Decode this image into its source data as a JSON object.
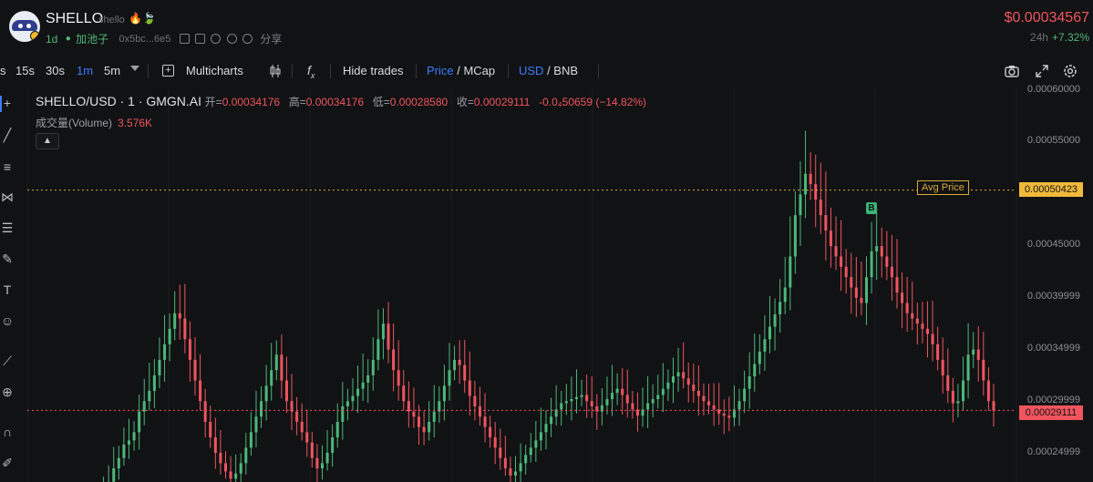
{
  "header": {
    "token_name": "SHELLO",
    "token_sub": "shello",
    "flame_icon": "🔥",
    "leaf_icon": "🍃",
    "age": "1d",
    "pool_icon": "pool-icon",
    "pool_label": "加池子",
    "address": "0x5bc...6e5",
    "share_label": "分享",
    "price": "$0.00034567",
    "change_period": "24h",
    "change_value": "+7.32%"
  },
  "toolbar": {
    "intervals": [
      "s",
      "15s",
      "30s",
      "1m",
      "5m"
    ],
    "active_interval": "1m",
    "multicharts_label": "Multicharts",
    "hide_trades_label": "Hide trades",
    "price_label": "Price",
    "slash1": " / ",
    "mcap_label": "MCap",
    "usd_label": "USD",
    "slash2": " / ",
    "bnb_label": "BNB"
  },
  "legend": {
    "pair": "SHELLO/USD · 1 · GMGN.AI",
    "open_label": "开=",
    "open_value": "0.00034176",
    "high_label": "高=",
    "high_value": "0.00034176",
    "low_label": "低=",
    "low_value": "0.00028580",
    "close_label": "收=",
    "close_value": "0.00029111",
    "change_value": "-0.0₄50659 (−14.82%)",
    "volume_label": "成交量(Volume)",
    "volume_value": "3.576K"
  },
  "price_axis": {
    "ticks": [
      "0.00060000",
      "0.00055000",
      "0.00045000",
      "0.00039999",
      "0.00034999",
      "0.00029999",
      "0.00024999"
    ],
    "avg_label": "Avg Price",
    "avg_price": "0.00050423",
    "current_price": "0.00029111",
    "buy_marker": "B"
  },
  "colors": {
    "up": "#4db87a",
    "down": "#f0555f",
    "accent": "#3d7bff",
    "avg": "#f0b93a"
  },
  "chart_data": {
    "type": "candlestick",
    "ylim": [
      0.000225,
      0.0006
    ],
    "avg_price": 0.00050423,
    "current_price": 0.00029111,
    "close_series": [
      0.00021,
      0.000215,
      0.000222,
      0.000235,
      0.000245,
      0.000258,
      0.000262,
      0.00027,
      0.00029,
      0.0003,
      0.00031,
      0.000325,
      0.00034,
      0.000355,
      0.00037,
      0.000385,
      0.00038,
      0.00036,
      0.00034,
      0.00032,
      0.0003,
      0.00028,
      0.000265,
      0.00025,
      0.00024,
      0.000232,
      0.000225,
      0.00023,
      0.00024,
      0.000255,
      0.00027,
      0.000285,
      0.0003,
      0.000315,
      0.00033,
      0.000345,
      0.00032,
      0.0003,
      0.00029,
      0.00028,
      0.00027,
      0.00026,
      0.000245,
      0.000235,
      0.00024,
      0.00025,
      0.000265,
      0.00028,
      0.000295,
      0.0003,
      0.000305,
      0.000312,
      0.000318,
      0.000325,
      0.00034,
      0.00036,
      0.000375,
      0.00035,
      0.00033,
      0.000315,
      0.0003,
      0.00029,
      0.000285,
      0.000275,
      0.00027,
      0.00028,
      0.00029,
      0.0003,
      0.000315,
      0.00033,
      0.00034,
      0.000335,
      0.00032,
      0.000305,
      0.000295,
      0.000285,
      0.000275,
      0.000265,
      0.000255,
      0.000245,
      0.000235,
      0.000228,
      0.000232,
      0.00024,
      0.000248,
      0.000255,
      0.000262,
      0.00027,
      0.000278,
      0.000285,
      0.000292,
      0.000298,
      0.0003,
      0.000302,
      0.000304,
      0.000306,
      0.0003,
      0.000295,
      0.00029,
      0.000296,
      0.000302,
      0.000308,
      0.000312,
      0.000306,
      0.000298,
      0.000292,
      0.000286,
      0.000292,
      0.000298,
      0.000302,
      0.000306,
      0.000312,
      0.000318,
      0.000324,
      0.000328,
      0.000322,
      0.000316,
      0.00031,
      0.000305,
      0.0003,
      0.000296,
      0.000292,
      0.000288,
      0.000286,
      0.000284,
      0.000292,
      0.0003,
      0.000312,
      0.000324,
      0.000336,
      0.000348,
      0.00036,
      0.000372,
      0.000384,
      0.000396,
      0.00041,
      0.00044,
      0.00048,
      0.0005,
      0.00052,
      0.00051,
      0.000495,
      0.00048,
      0.000465,
      0.00045,
      0.00044,
      0.00043,
      0.00042,
      0.00041,
      0.0004,
      0.000395,
      0.00042,
      0.000445,
      0.00045,
      0.00044,
      0.00043,
      0.00042,
      0.000405,
      0.000395,
      0.000385,
      0.00038,
      0.000375,
      0.00037,
      0.000365,
      0.000355,
      0.00034,
      0.000325,
      0.00031,
      0.000298,
      0.0003,
      0.00032,
      0.000345,
      0.00035,
      0.00034,
      0.00032,
      0.0003,
      0.00029111
    ]
  }
}
